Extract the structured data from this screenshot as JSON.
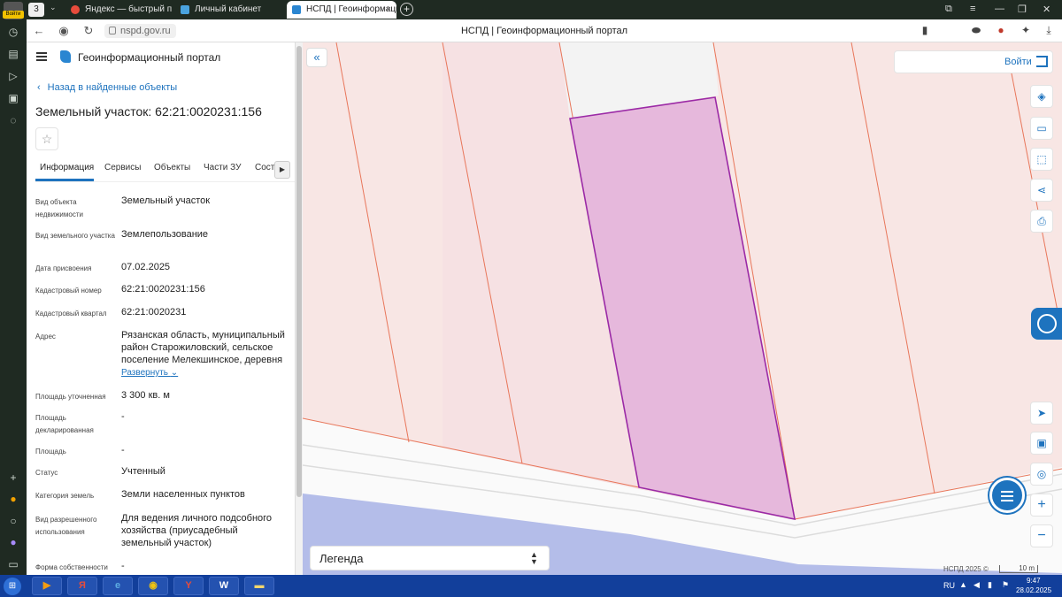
{
  "browser": {
    "profile_label": "Войти",
    "tab_count": "3",
    "tabs": [
      {
        "label": "Яндекс — быстрый поиск"
      },
      {
        "label": "Личный кабинет"
      },
      {
        "label": "НСПД | Геоинформаци..."
      }
    ],
    "url": "nspd.gov.ru",
    "page_title": "НСПД | Геоинформационный портал"
  },
  "portal": {
    "title": "Геоинформационный портал",
    "back_label": "Назад в найденные объекты",
    "object_title": "Земельный участок: 62:21:0020231:156",
    "tabs": [
      "Информация",
      "Сервисы",
      "Объекты",
      "Части ЗУ",
      "Соста..."
    ],
    "expand_label": "Развернуть",
    "fields": [
      {
        "label": "Вид объекта недвижимости",
        "value": "Земельный участок"
      },
      {
        "label": "Вид земельного участка",
        "value": "Землепользование"
      },
      {
        "label": "Дата присвоения",
        "value": "07.02.2025"
      },
      {
        "label": "Кадастровый номер",
        "value": "62:21:0020231:156"
      },
      {
        "label": "Кадастровый квартал",
        "value": "62:21:0020231"
      },
      {
        "label": "Адрес",
        "value": "Рязанская область, муниципальный район Старожиловский, сельское поселение Мелекшинское, деревня"
      },
      {
        "label": "Площадь уточненная",
        "value": "3 300 кв. м"
      },
      {
        "label": "Площадь декларированная",
        "value": "-"
      },
      {
        "label": "Площадь",
        "value": "-"
      },
      {
        "label": "Статус",
        "value": "Учтенный"
      },
      {
        "label": "Категория земель",
        "value": "Земли населенных пунктов"
      },
      {
        "label": "Вид разрешенного использования",
        "value": "Для ведения личного подсобного хозяйства (приусадебный земельный участок)"
      },
      {
        "label": "Форма собственности",
        "value": "-"
      }
    ]
  },
  "map": {
    "login_label": "Войти",
    "legend_label": "Легенда",
    "copyright": "НСПД 2025 ©",
    "scale_label": "10 m",
    "tools": [
      "layers-icon",
      "ruler-icon",
      "select-area-icon",
      "share-icon",
      "print-icon",
      "locate-icon",
      "minimap-icon",
      "geo-icon",
      "zoom-in-icon",
      "zoom-out-icon"
    ],
    "tool_symbols": [
      "◈",
      "▭",
      "⬚",
      "⋖",
      "⎙",
      "➤",
      "▣",
      "◎",
      "+",
      "−"
    ],
    "colors": {
      "parcel_fill": "#e6b8dc",
      "parcel_stroke": "#9b2aa6",
      "neighbor_stroke": "#e8765a",
      "water": "#b4bde9",
      "accent": "#1e73be"
    }
  },
  "taskbar": {
    "lang": "RU",
    "time": "9:47",
    "date": "28.02.2025"
  }
}
